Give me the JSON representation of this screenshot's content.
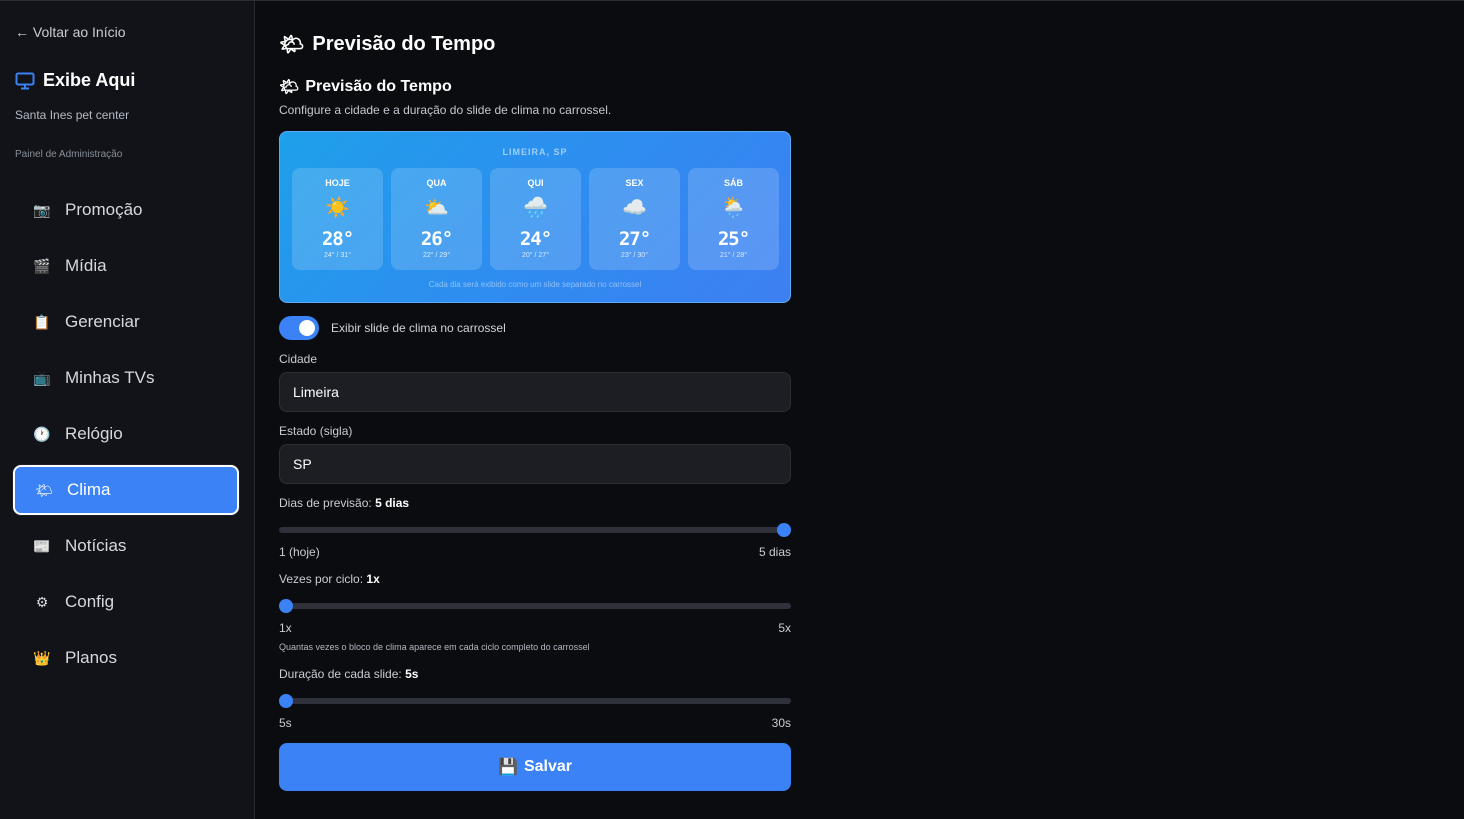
{
  "sidebar": {
    "back_link": "← Voltar ao Início",
    "brand_name": "Exibe Aqui",
    "brand_subtitle": "Santa Ines pet center",
    "admin_label": "Painel de Administração",
    "items": [
      {
        "label": "Promoção",
        "icon": "📷"
      },
      {
        "label": "Mídia",
        "icon": "🎬"
      },
      {
        "label": "Gerenciar",
        "icon": "📋"
      },
      {
        "label": "Minhas TVs",
        "icon": "📺"
      },
      {
        "label": "Relógio",
        "icon": "🕐"
      },
      {
        "label": "Clima",
        "icon": "🌤",
        "active": true
      },
      {
        "label": "Notícias",
        "icon": "📰"
      },
      {
        "label": "Config",
        "icon": "⚙"
      },
      {
        "label": "Planos",
        "icon": "👑"
      }
    ]
  },
  "main": {
    "page_title": "Previsão do Tempo",
    "page_icon": "🌤",
    "section_title": "Previsão do Tempo",
    "section_description": "Configure a cidade e a duração do slide de clima no carrossel.",
    "preview": {
      "city": "LIMEIRA, SP",
      "days": [
        {
          "day": "HOJE",
          "icon": "☀️",
          "temp": "28°",
          "range": "24° / 31°"
        },
        {
          "day": "QUA",
          "icon": "⛅",
          "temp": "26°",
          "range": "22° / 29°"
        },
        {
          "day": "QUI",
          "icon": "🌧️",
          "temp": "24°",
          "range": "20° / 27°"
        },
        {
          "day": "SEX",
          "icon": "☁️",
          "temp": "27°",
          "range": "23° / 30°"
        },
        {
          "day": "SÁB",
          "icon": "🌦️",
          "temp": "25°",
          "range": "21° / 28°"
        }
      ],
      "note": "Cada dia será exibido como um slide separado no carrossel"
    },
    "toggle": {
      "label": "Exibir slide de clima no carrossel",
      "on": true
    },
    "city": {
      "label": "Cidade",
      "value": "Limeira"
    },
    "state": {
      "label": "Estado (sigla)",
      "value": "SP"
    },
    "forecast_days": {
      "label": "Dias de previsão:",
      "value_text": "5 dias",
      "value": 5,
      "min": 1,
      "max": 5,
      "min_label": "1 (hoje)",
      "max_label": "5 dias"
    },
    "times_per_cycle": {
      "label": "Vezes por ciclo:",
      "value_text": "1x",
      "value": 1,
      "min": 1,
      "max": 5,
      "min_label": "1x",
      "max_label": "5x",
      "hint": "Quantas vezes o bloco de clima aparece em cada ciclo completo do carrossel"
    },
    "slide_duration": {
      "label": "Duração de cada slide:",
      "value_text": "5s",
      "value": 5,
      "min": 5,
      "max": 30,
      "min_label": "5s",
      "max_label": "30s"
    },
    "save_button": {
      "label": "Salvar",
      "icon": "💾"
    }
  },
  "colors": {
    "accent": "#3b82f6",
    "sidebar_bg": "#111318",
    "main_bg": "#0b0c10"
  }
}
